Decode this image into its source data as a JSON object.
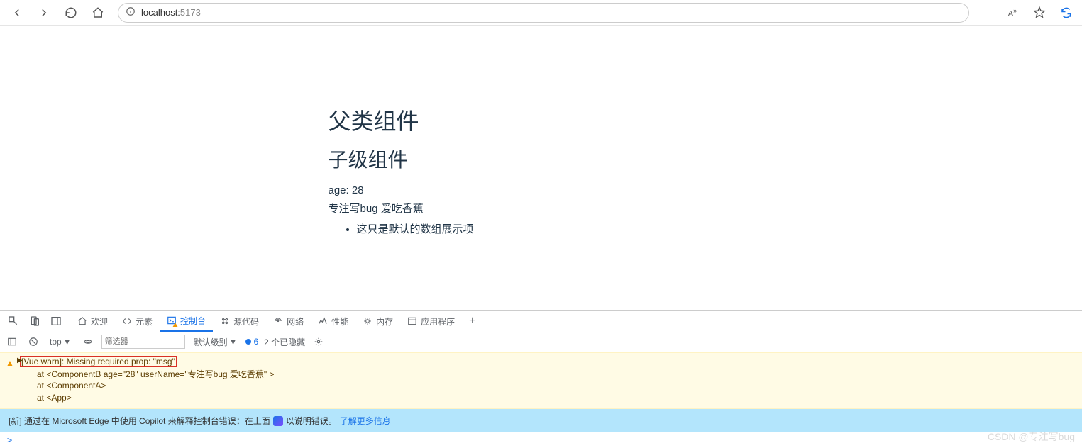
{
  "browser": {
    "url_host": "localhost:",
    "url_port": "5173",
    "aa_icon": "A",
    "sync_label": "⟳"
  },
  "page": {
    "parent_title": "父类组件",
    "child_title": "子级组件",
    "age_line": "age: 28",
    "desc_line": "专注写bug 爱吃香蕉",
    "list_item": "这只是默认的数组展示项"
  },
  "devtools": {
    "tabs": {
      "welcome": "欢迎",
      "elements": "元素",
      "console": "控制台",
      "sources": "源代码",
      "network": "网络",
      "performance": "性能",
      "memory": "内存",
      "application": "应用程序"
    },
    "console_toolbar": {
      "context": "top",
      "filter_placeholder": "筛选器",
      "level": "默认级别",
      "issue_count": "6",
      "hidden_text": "2 个已隐藏"
    },
    "warning": {
      "main": "[Vue warn]: Missing required prop: \"msg\"",
      "line1": "at <ComponentB age=\"28\" userName=\"专注写bug 爱吃香蕉\" >",
      "line2": "at <ComponentA>",
      "line3": "at <App>"
    },
    "banner": {
      "prefix": "[新] 通过在 Microsoft Edge 中使用 Copilot 来解释控制台错误：在上面",
      "mid": "以说明错误。",
      "link": "了解更多信息"
    },
    "prompt": ">"
  },
  "watermark": "CSDN @专注写bug"
}
